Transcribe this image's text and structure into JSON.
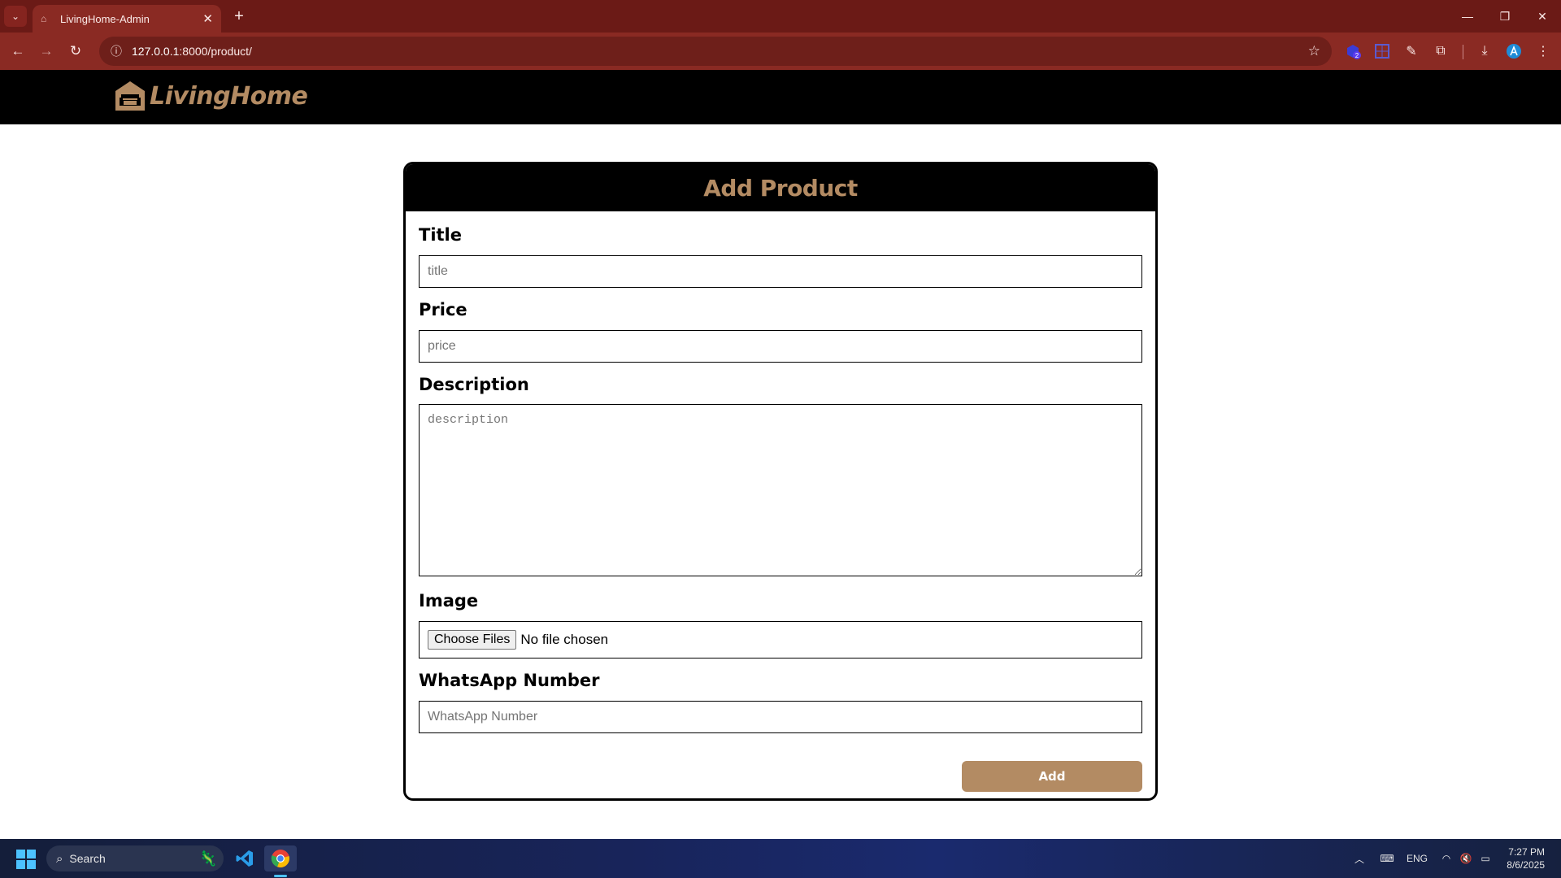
{
  "browser": {
    "tab_title": "LivingHome-Admin",
    "url_host": "127.0.0.1",
    "url_rest": ":8000/product/",
    "icons": [
      "tab-search-icon",
      "new-tab-icon",
      "back-icon",
      "forward-icon",
      "reload-icon",
      "site-info-icon",
      "bookmark-star-icon",
      "extensions-icon",
      "downloads-icon",
      "menu-icon"
    ],
    "extension_badge": "2"
  },
  "site": {
    "brand": "LivingHome",
    "brand_color": "#b38b63"
  },
  "form": {
    "heading": "Add Product",
    "title_label": "Title",
    "title_placeholder": "title",
    "price_label": "Price",
    "price_placeholder": "price",
    "description_label": "Description",
    "description_placeholder": "description",
    "image_label": "Image",
    "file_button": "Choose Files",
    "file_status": "No file chosen",
    "whatsapp_label": "WhatsApp Number",
    "whatsapp_placeholder": "WhatsApp Number",
    "submit_label": "Add"
  },
  "taskbar": {
    "search_label": "Search",
    "language": "ENG",
    "time": "7:27 PM",
    "date": "8/6/2025"
  }
}
